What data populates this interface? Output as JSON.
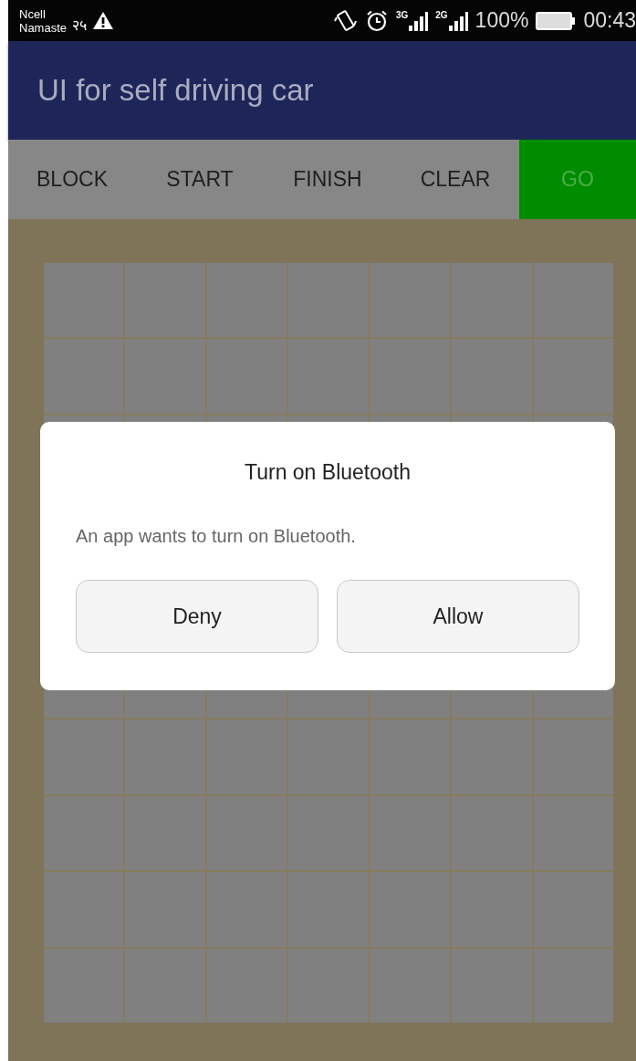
{
  "status_bar": {
    "carrier": [
      "Ncell",
      "Namaste"
    ],
    "notification": "२५",
    "network_labels": [
      "3G",
      "2G"
    ],
    "battery": "100%",
    "time": "00:43"
  },
  "app_bar": {
    "title": "UI for self driving car"
  },
  "toolbar": [
    {
      "label": "BLOCK",
      "kind": "plain"
    },
    {
      "label": "START",
      "kind": "plain"
    },
    {
      "label": "FINISH",
      "kind": "plain"
    },
    {
      "label": "CLEAR",
      "kind": "plain"
    },
    {
      "label": "GO",
      "kind": "primary"
    }
  ],
  "grid": {
    "rows_above_dialog": [
      {
        "cells": [
          {
            "kind": "empty"
          },
          {
            "kind": "empty"
          },
          {
            "kind": "empty"
          },
          {
            "kind": "empty"
          },
          {
            "kind": "empty"
          },
          {
            "kind": "empty"
          },
          {
            "kind": "empty"
          }
        ]
      },
      {
        "cells": [
          {
            "kind": "empty"
          },
          {
            "kind": "empty"
          },
          {
            "kind": "empty"
          },
          {
            "kind": "empty"
          },
          {
            "kind": "empty"
          },
          {
            "kind": "empty"
          },
          {
            "kind": "empty"
          }
        ]
      },
      {
        "cells": [
          {
            "kind": "empty"
          },
          {
            "kind": "empty"
          },
          {
            "kind": "empty"
          },
          {
            "kind": "empty"
          },
          {
            "kind": "empty"
          },
          {
            "kind": "empty"
          },
          {
            "kind": "empty"
          }
        ]
      }
    ],
    "rows_below_dialog": [
      {
        "cells": [
          {
            "kind": "empty"
          },
          {
            "kind": "empty"
          },
          {
            "kind": "empty"
          },
          {
            "kind": "empty"
          },
          {
            "kind": "empty"
          },
          {
            "kind": "empty"
          },
          {
            "kind": "empty"
          }
        ]
      },
      {
        "cells": [
          {
            "kind": "empty"
          },
          {
            "kind": "empty"
          },
          {
            "kind": "empty"
          },
          {
            "kind": "empty"
          },
          {
            "kind": "empty"
          },
          {
            "kind": "empty"
          },
          {
            "kind": "empty"
          }
        ]
      },
      {
        "cells": [
          {
            "kind": "empty"
          },
          {
            "kind": "empty"
          },
          {
            "kind": "empty"
          },
          {
            "kind": "empty"
          },
          {
            "kind": "empty"
          },
          {
            "kind": "empty"
          },
          {
            "kind": "empty"
          }
        ]
      },
      {
        "cells": [
          {
            "kind": "empty"
          },
          {
            "kind": "empty"
          },
          {
            "kind": "empty"
          },
          {
            "kind": "empty"
          },
          {
            "kind": "empty"
          },
          {
            "kind": "empty"
          },
          {
            "kind": "empty"
          }
        ]
      },
      {
        "cells": [
          {
            "kind": "empty"
          },
          {
            "kind": "empty"
          },
          {
            "kind": "empty"
          },
          {
            "kind": "empty"
          },
          {
            "kind": "empty"
          },
          {
            "kind": "empty"
          },
          {
            "kind": "empty"
          }
        ]
      }
    ]
  },
  "dialog": {
    "title": "Turn on Bluetooth",
    "message": "An app wants to turn on Bluetooth.",
    "buttons": [
      "Deny",
      "Allow"
    ]
  }
}
